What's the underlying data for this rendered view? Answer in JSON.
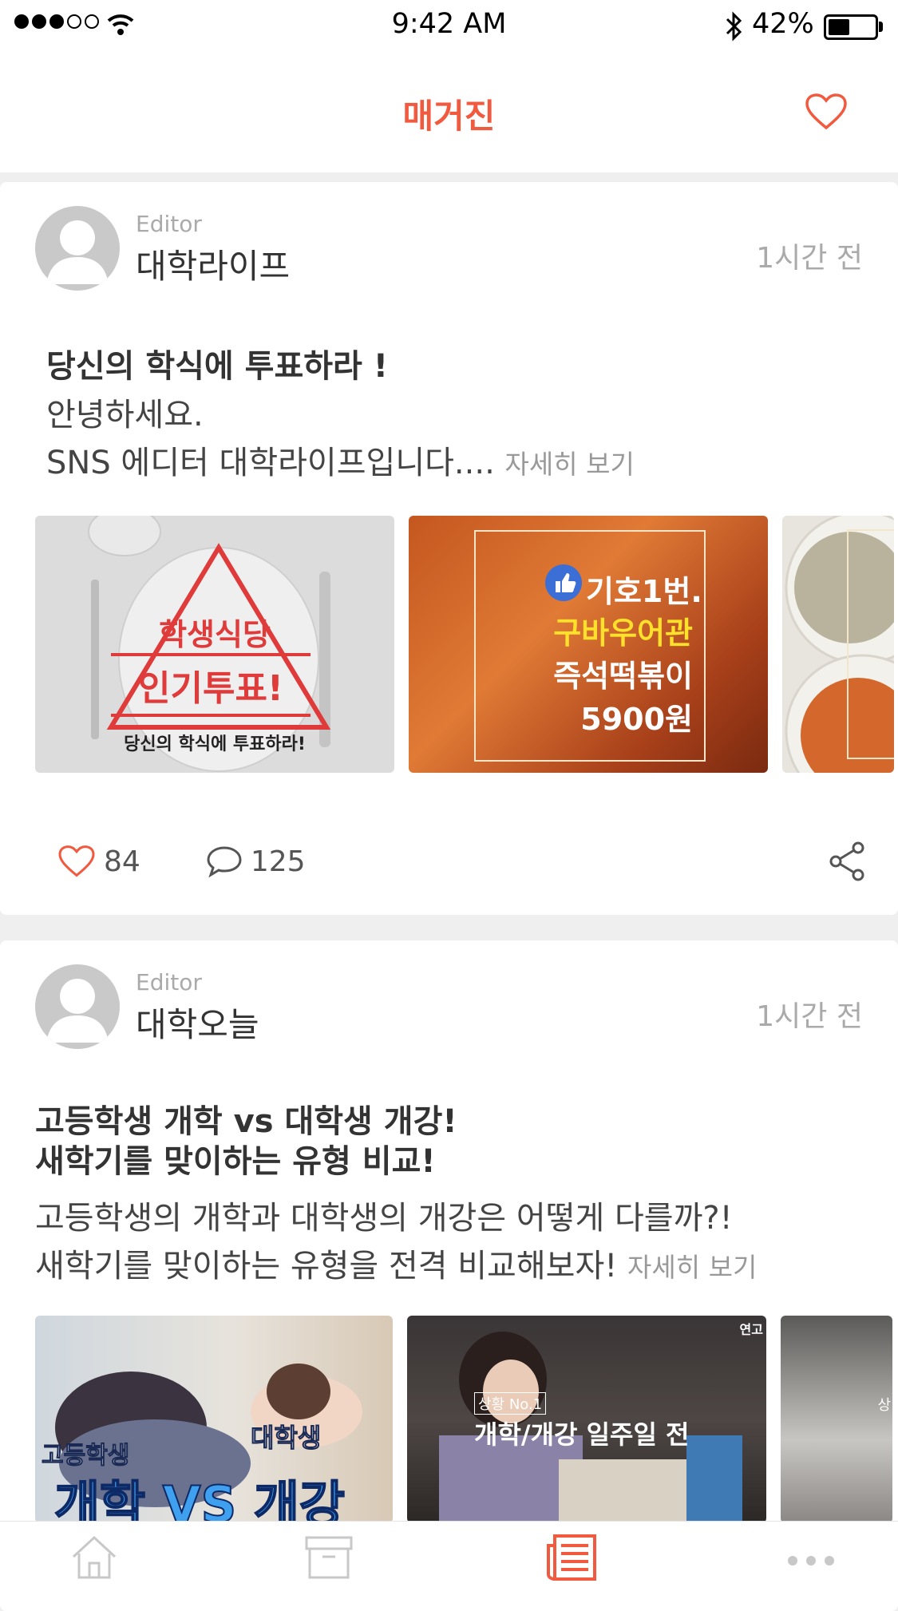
{
  "status": {
    "time": "9:42 AM",
    "battery": "42%"
  },
  "header": {
    "title": "매거진"
  },
  "posts": [
    {
      "editor_label": "Editor",
      "editor_name": "대학라이프",
      "time_ago": "1시간 전",
      "title": "당신의 학식에 투표하라 !",
      "body_lines": [
        "안녕하세요.",
        "SNS 에디터 대학라이프입니다...."
      ],
      "more": "자세히 보기",
      "images": [
        {
          "line1": "학생식당",
          "line2": "인기투표!",
          "caption": "당신의 학식에 투표하라!"
        },
        {
          "line1": "기호1번.",
          "line2": "구바우어관",
          "line3": "즉석떡볶이",
          "line4": "5900원"
        }
      ],
      "likes": "84",
      "comments": "125"
    },
    {
      "editor_label": "Editor",
      "editor_name": "대학오늘",
      "time_ago": "1시간 전",
      "title_lines": [
        "고등학생 개학 vs 대학생 개강!",
        "새학기를 맞이하는 유형 비교!"
      ],
      "body_lines": [
        "고등학생의 개학과 대학생의 개강은 어떻게 다를까?!",
        "새학기를 맞이하는 유형을 전격 비교해보자!"
      ],
      "more": "자세히 보기",
      "images": [
        {
          "left": "고등학생",
          "right": "대학생",
          "big": "개학 VS 개강"
        },
        {
          "badge": "상황 No.1",
          "text": "개학/개강 일주일 전",
          "corner": "연고"
        },
        {
          "corner": "상"
        }
      ]
    }
  ],
  "tabs": [
    "home-tab",
    "archive-tab",
    "magazine-tab",
    "more-tab"
  ],
  "colors": {
    "accent": "#f15a3e",
    "muted": "#aaaaaa",
    "icon_gray": "#c8c8c8"
  }
}
